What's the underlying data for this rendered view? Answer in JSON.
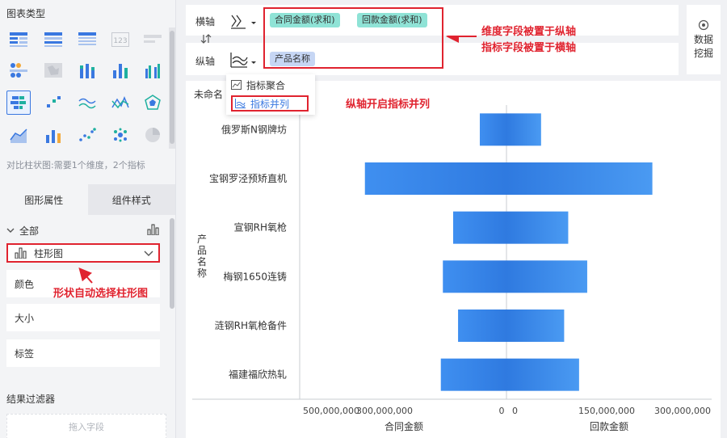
{
  "left_panel": {
    "section_title": "图表类型",
    "hint": "对比柱状图:需要1个维度，2个指标",
    "tabs": [
      {
        "label": "图形属性"
      },
      {
        "label": "组件样式"
      }
    ],
    "all_label": "全部",
    "shape_select": {
      "value": "柱形图"
    },
    "props": [
      {
        "label": "颜色"
      },
      {
        "label": "大小"
      },
      {
        "label": "标签"
      }
    ],
    "shape_annotation": "形状自动选择柱形图",
    "filter_title": "结果过滤器",
    "drop_placeholder": "拖入字段"
  },
  "axis": {
    "x_label": "横轴",
    "y_label": "纵轴",
    "x_fields": [
      "合同金额(求和)",
      "回款金额(求和)"
    ],
    "y_fields": [
      "产品名称"
    ],
    "annotation_line1": "维度字段被置于纵轴",
    "annotation_line2": "指标字段被置于横轴"
  },
  "mining": {
    "line1": "数据",
    "line2": "挖掘"
  },
  "dropdown": {
    "items": [
      {
        "label": "指标聚合"
      },
      {
        "label": "指标并列"
      }
    ],
    "annotation": "纵轴开启指标并列"
  },
  "chart": {
    "title": "未命名",
    "accent": "#3a8ee6"
  },
  "chart_data": {
    "type": "bar",
    "orientation": "horizontal",
    "ylabel": "产品名称",
    "categories": [
      "俄罗斯N钢牌坊",
      "宝钢罗泾预矫直机",
      "宣钢RH氧枪",
      "梅钢1650连铸",
      "涟钢RH氧枪备件",
      "福建福欣热轧"
    ],
    "series": [
      {
        "name": "合同金额",
        "direction": "left",
        "values": [
          65000000,
          345000000,
          130000000,
          155000000,
          118000000,
          160000000
        ],
        "xlim": [
          0,
          500000000
        ],
        "ticks": [
          "500,000,000",
          "300,000,000",
          "0"
        ]
      },
      {
        "name": "回款金额",
        "direction": "right",
        "values": [
          51000000,
          215000000,
          91000000,
          119000000,
          85000000,
          107000000
        ],
        "xlim": [
          0,
          300000000
        ],
        "ticks": [
          "0",
          "150,000,000",
          "300,000,000"
        ]
      }
    ],
    "tick_labels": [
      "500,000,000",
      "300,000,000",
      "0",
      "0",
      "150,000,000",
      "300,000,000"
    ],
    "x_axis_labels": [
      "合同金额",
      "回款金额"
    ]
  }
}
